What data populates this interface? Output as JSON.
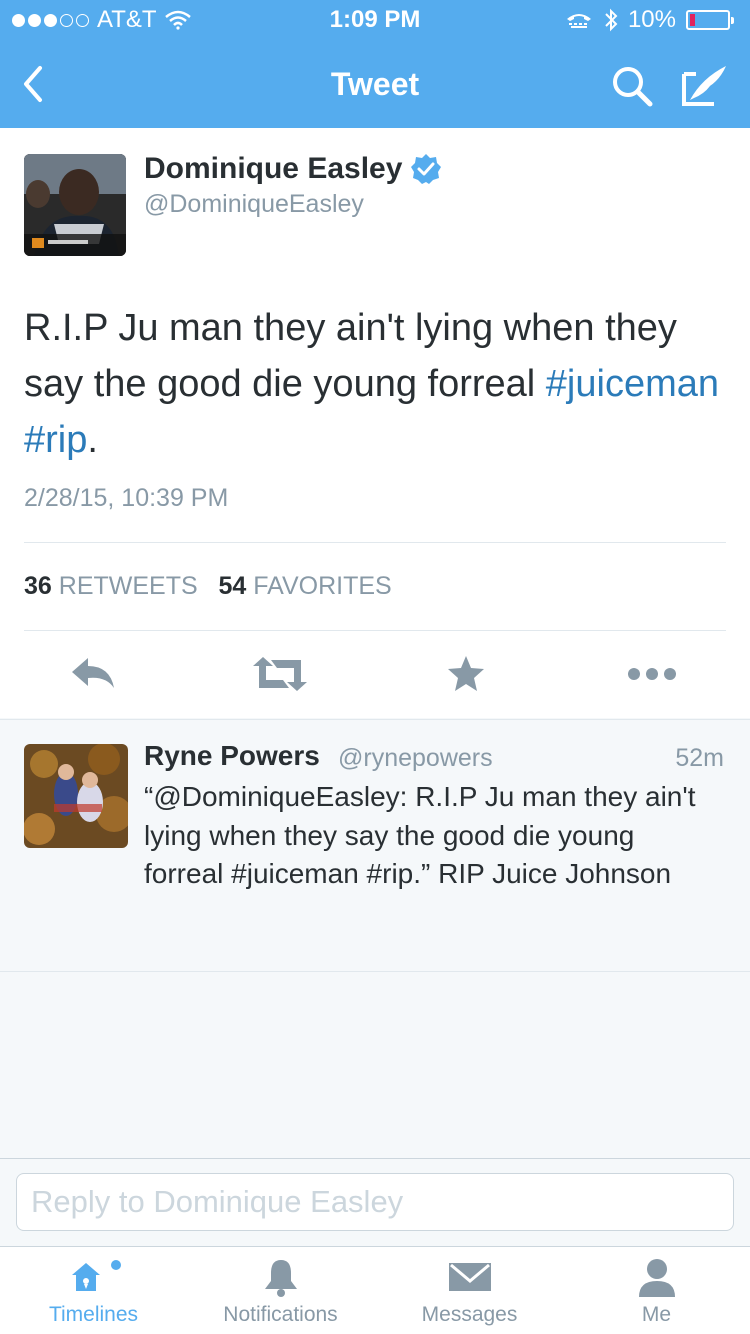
{
  "status_bar": {
    "carrier": "AT&T",
    "time": "1:09 PM",
    "battery": "10%",
    "signal_bars": 3,
    "battery_level": 0.1
  },
  "nav": {
    "title": "Tweet"
  },
  "tweet": {
    "author_name": "Dominique Easley",
    "author_handle": "@DominiqueEasley",
    "verified": true,
    "text_plain": "R.I.P Ju man they ain't lying when they say the good die young forreal ",
    "hashtag_1": "#juiceman",
    "space": " ",
    "hashtag_2": "#rip",
    "text_end": ".",
    "date": "2/28/15, 10:39 PM",
    "retweets_count": "36",
    "retweets_label": "RETWEETS",
    "favorites_count": "54",
    "favorites_label": "FAVORITES"
  },
  "reply_tweet": {
    "author_name": "Ryne Powers",
    "author_handle": "@rynepowers",
    "time_ago": "52m",
    "text": "“@DominiqueEasley: R.I.P Ju man they ain't lying when they say the good die young forreal #juiceman #rip.”  RIP Juice Johnson"
  },
  "reply_bar": {
    "placeholder": "Reply to Dominique Easley"
  },
  "tabs": [
    {
      "label": "Timelines",
      "icon": "home-icon",
      "active": true
    },
    {
      "label": "Notifications",
      "icon": "bell-icon",
      "active": false
    },
    {
      "label": "Messages",
      "icon": "envelope-icon",
      "active": false
    },
    {
      "label": "Me",
      "icon": "person-icon",
      "active": false
    }
  ],
  "colors": {
    "accent": "#55acee",
    "link": "#2b7bb9",
    "muted": "#8899a6",
    "text": "#292f33"
  }
}
